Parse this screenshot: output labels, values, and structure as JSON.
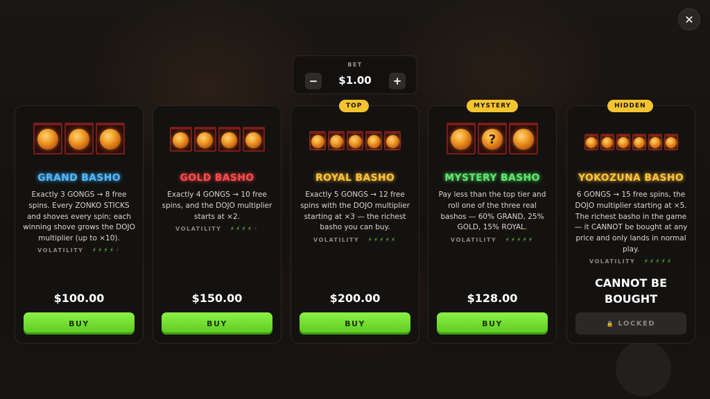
{
  "close_icon": "✕",
  "bet": {
    "label": "BET",
    "value": "$1.00",
    "minus": "−",
    "plus": "+"
  },
  "cards": [
    {
      "title": "GRAND BASHO",
      "title_color": "#4fb8ff",
      "desc": "Exactly 3 GONGS → 8 free spins. Every ZONKO STICKS and shoves every spin; each winning shove grows the DOJO multiplier (up to ×10).",
      "volatility_label": "VOLATILITY",
      "volatility_level": 4,
      "volatility_max": 5,
      "price": "$100.00",
      "button": "BUY",
      "gongs": 3
    },
    {
      "title": "GOLD BASHO",
      "title_color": "#ff4b4b",
      "desc": "Exactly 4 GONGS → 10 free spins, and the DOJO multiplier starts at ×2.",
      "volatility_label": "VOLATILITY",
      "volatility_level": 4,
      "volatility_max": 5,
      "price": "$150.00",
      "button": "BUY",
      "gongs": 4
    },
    {
      "tag": "TOP",
      "title": "ROYAL BASHO",
      "title_color": "#ffc23a",
      "desc": "Exactly 5 GONGS → 12 free spins with the DOJO multiplier starting at ×3 — the richest basho you can buy.",
      "volatility_label": "VOLATILITY",
      "volatility_level": 5,
      "volatility_max": 5,
      "price": "$200.00",
      "button": "BUY",
      "gongs": 5
    },
    {
      "tag": "MYSTERY",
      "title": "MYSTERY BASHO",
      "title_color": "#5ee86a",
      "desc": "Pay less than the top tier and roll one of the three real bashos — 60% GRAND, 25% GOLD, 15% ROYAL.",
      "volatility_label": "VOLATILITY",
      "volatility_level": 5,
      "volatility_max": 5,
      "price": "$128.00",
      "button": "BUY",
      "gongs": 3,
      "mystery_mark": "?"
    },
    {
      "tag": "HIDDEN",
      "title": "YOKOZUNA BASHO",
      "title_color": "#ffc23a",
      "desc": "6 GONGS → 15 free spins, the DOJO multiplier starting at ×5. The richest basho in the game — it CANNOT be bought at any price and only lands in normal play.",
      "volatility_label": "VOLATILITY",
      "volatility_level": 5,
      "volatility_max": 5,
      "cannot_line1": "CANNOT BE",
      "cannot_line2": "BOUGHT",
      "button": "LOCKED",
      "lock_icon": "🔒",
      "gongs": 6
    }
  ]
}
